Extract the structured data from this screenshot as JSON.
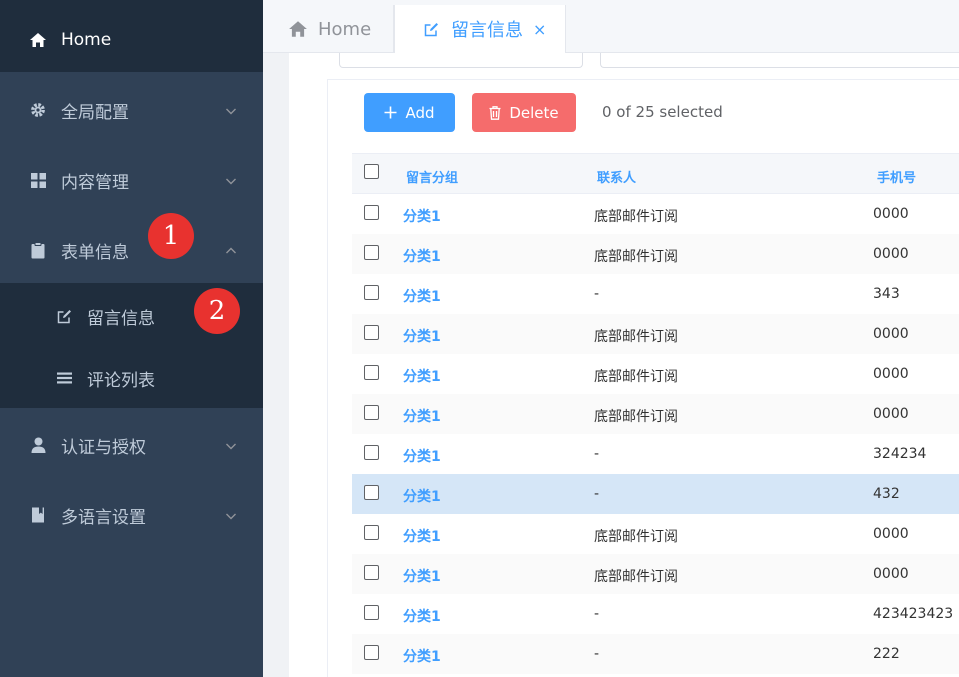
{
  "sidebar": {
    "items": [
      {
        "label": "Home",
        "icon": "home-icon"
      },
      {
        "label": "全局配置",
        "icon": "gear-icon"
      },
      {
        "label": "内容管理",
        "icon": "grid-icon"
      },
      {
        "label": "表单信息",
        "icon": "clipboard-icon"
      },
      {
        "label": "认证与授权",
        "icon": "user-icon"
      },
      {
        "label": "多语言设置",
        "icon": "book-icon"
      }
    ],
    "subitems": [
      {
        "label": "留言信息",
        "icon": "edit-icon"
      },
      {
        "label": "评论列表",
        "icon": "list-icon"
      }
    ],
    "badges": [
      "1",
      "2"
    ]
  },
  "tabs": {
    "home": "Home",
    "active": "留言信息",
    "close": "×"
  },
  "toolbar": {
    "add_label": "Add",
    "delete_label": "Delete",
    "selected_text": "0 of 25 selected"
  },
  "table": {
    "headers": [
      "留言分组",
      "联系人",
      "手机号"
    ],
    "rows": [
      [
        "分类1",
        "底部邮件订阅",
        "0000"
      ],
      [
        "分类1",
        "底部邮件订阅",
        "0000"
      ],
      [
        "分类1",
        "-",
        "343"
      ],
      [
        "分类1",
        "底部邮件订阅",
        "0000"
      ],
      [
        "分类1",
        "底部邮件订阅",
        "0000"
      ],
      [
        "分类1",
        "底部邮件订阅",
        "0000"
      ],
      [
        "分类1",
        "-",
        "324234"
      ],
      [
        "分类1",
        "-",
        "432"
      ],
      [
        "分类1",
        "底部邮件订阅",
        "0000"
      ],
      [
        "分类1",
        "底部邮件订阅",
        "0000"
      ],
      [
        "分类1",
        "-",
        "423423423"
      ],
      [
        "分类1",
        "-",
        "222"
      ]
    ]
  },
  "colors": {
    "sidebar_bg": "#304156",
    "sidebar_active_bg": "#1f2d3d",
    "accent": "#409eff",
    "danger": "#f56c6c",
    "badge": "#e8322f",
    "row_highlight": "#d5e6f7"
  }
}
